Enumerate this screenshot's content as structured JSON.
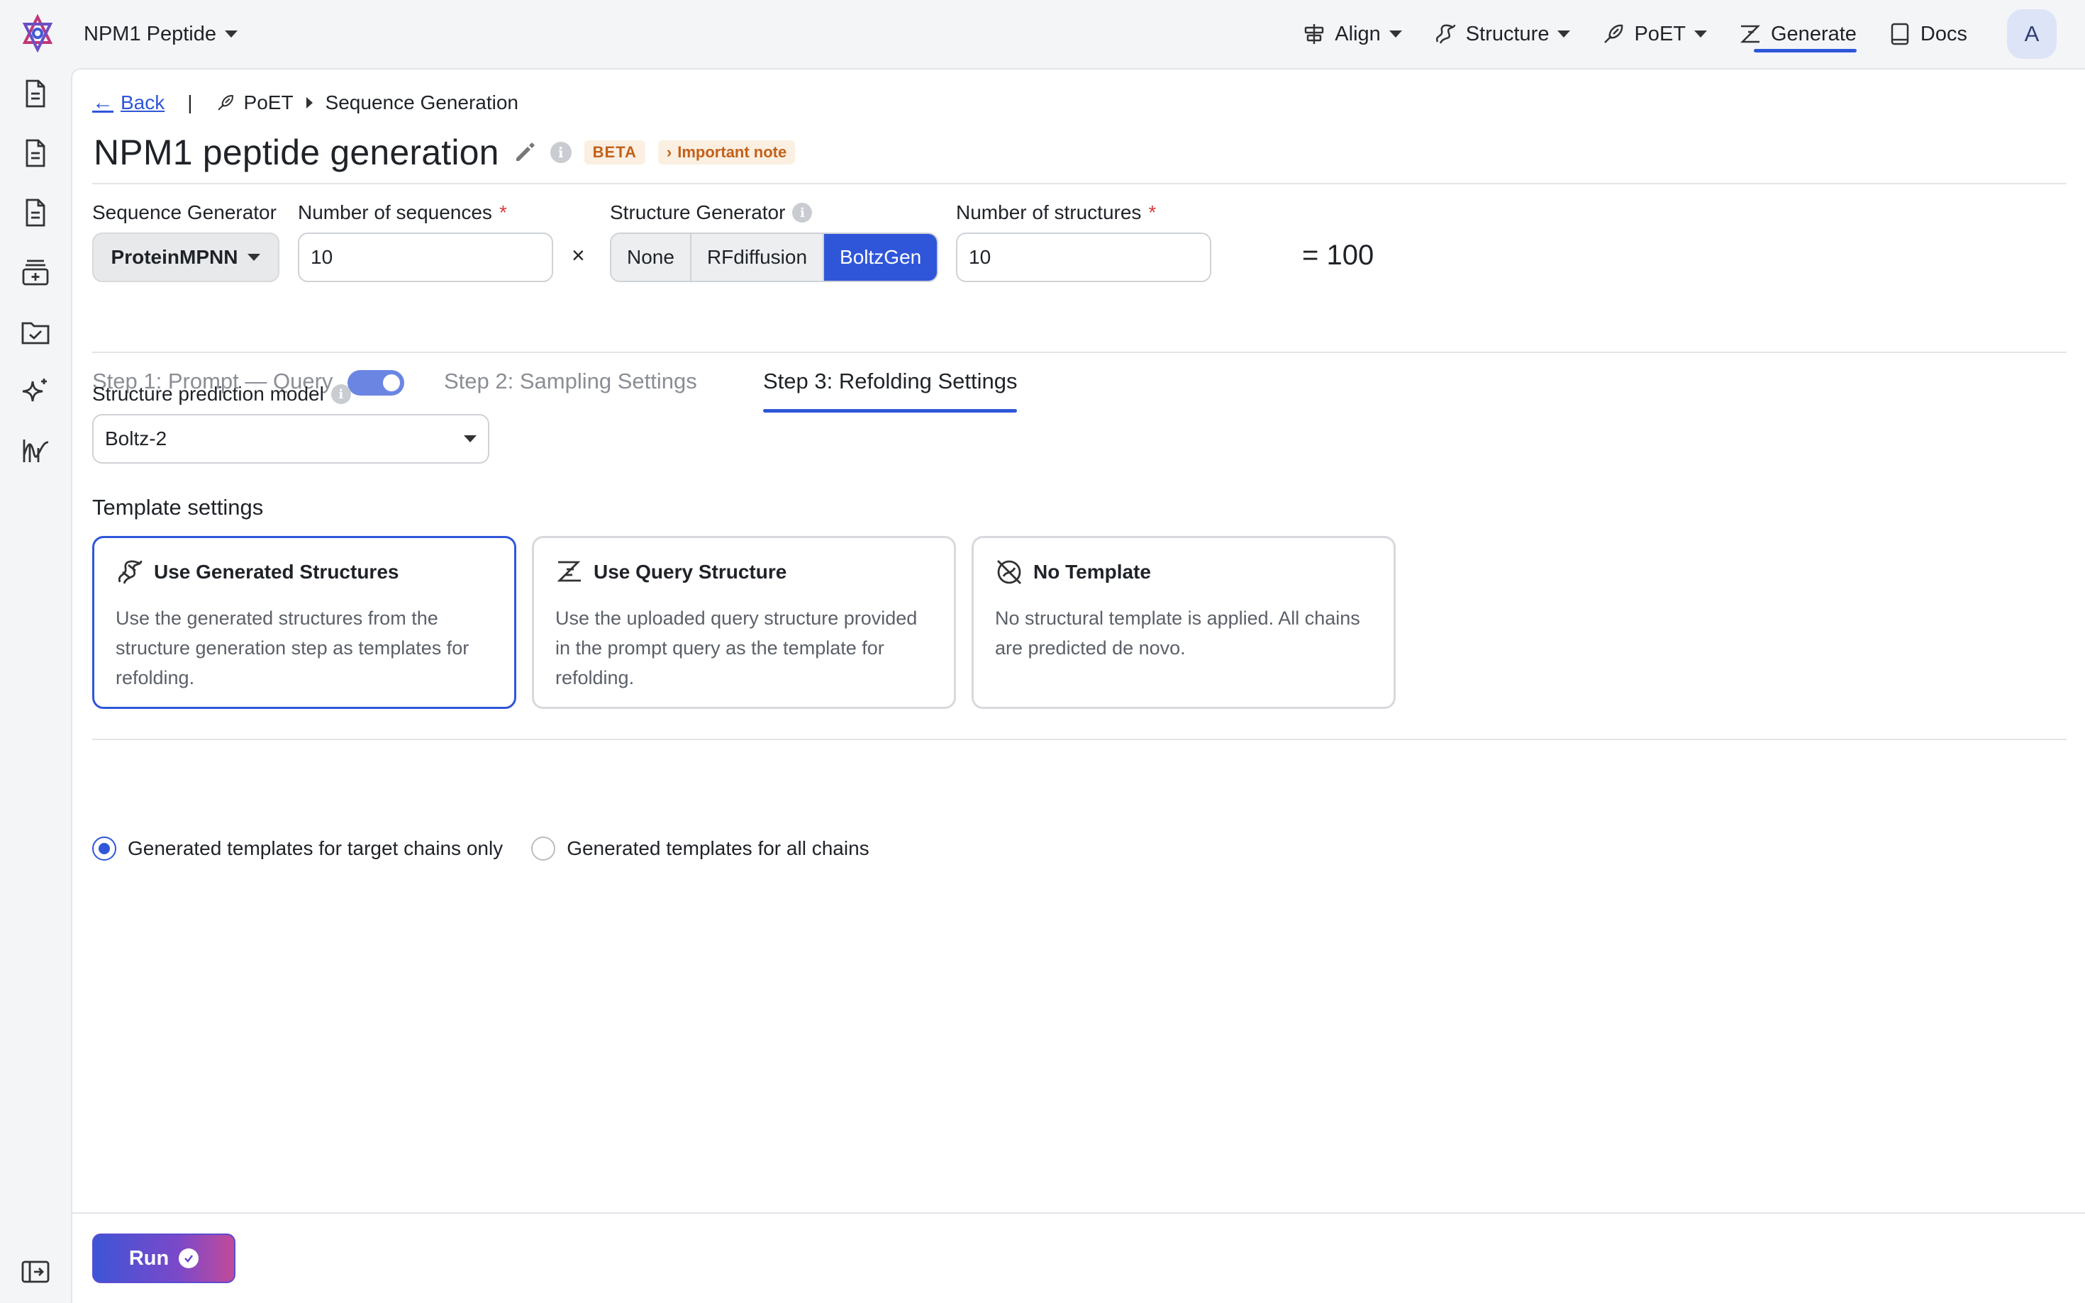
{
  "header": {
    "project_name": "NPM1 Peptide",
    "nav": [
      {
        "label": "Align",
        "icon": "align-icon",
        "dropdown": true
      },
      {
        "label": "Structure",
        "icon": "structure-icon",
        "dropdown": true
      },
      {
        "label": "PoET",
        "icon": "poet-icon",
        "dropdown": true
      },
      {
        "label": "Generate",
        "icon": "generate-icon",
        "active": true
      },
      {
        "label": "Docs",
        "icon": "docs-icon"
      }
    ],
    "avatar": "A"
  },
  "sidebar": {
    "icons": [
      "document-icon",
      "document-icon",
      "document-icon",
      "dataset-add-icon",
      "folder-check-icon",
      "sparkle-icon",
      "chart-wave-icon"
    ],
    "collapse_icon": "sidebar-expand-icon"
  },
  "breadcrumb": {
    "back": "Back",
    "separator": "|",
    "parent": "PoET",
    "current": "Sequence Generation"
  },
  "page": {
    "title": "NPM1 peptide generation",
    "beta": "BETA",
    "note": "Important note"
  },
  "config": {
    "sequence_generator_label": "Sequence Generator",
    "sequence_generator_value": "ProteinMPNN",
    "num_sequences_label": "Number of sequences",
    "num_sequences_value": "10",
    "required_mark": "*",
    "times": "×",
    "structure_generator_label": "Structure Generator",
    "structure_generators": [
      "None",
      "RFdiffusion",
      "BoltzGen"
    ],
    "structure_generator_selected": "BoltzGen",
    "num_structures_label": "Number of structures",
    "num_structures_value": "10",
    "total": "= 100"
  },
  "tabs": [
    {
      "label": "Step 1: Prompt — Query"
    },
    {
      "label": "Step 2: Sampling Settings"
    },
    {
      "label": "Step 3: Refolding Settings",
      "active": true
    }
  ],
  "refolding": {
    "model_label": "Structure prediction model",
    "model_value": "Boltz-2",
    "template_title": "Template settings",
    "cards": [
      {
        "title": "Use Generated Structures",
        "body": "Use the generated structures from the structure generation step as templates for refolding.",
        "selected": true
      },
      {
        "title": "Use Query Structure",
        "body": "Use the uploaded query structure provided in the prompt query as the template for refolding."
      },
      {
        "title": "No Template",
        "body": "No structural template is applied. All chains are predicted de novo."
      }
    ],
    "radios": [
      {
        "label": "Generated templates for target chains only",
        "checked": true
      },
      {
        "label": "Generated templates for all chains",
        "checked": false
      }
    ]
  },
  "footer": {
    "run_label": "Run"
  },
  "colors": {
    "accent": "#2f56d9",
    "badge_bg": "#fbefe1",
    "badge_text": "#c2611a",
    "required": "#d93b3b"
  }
}
